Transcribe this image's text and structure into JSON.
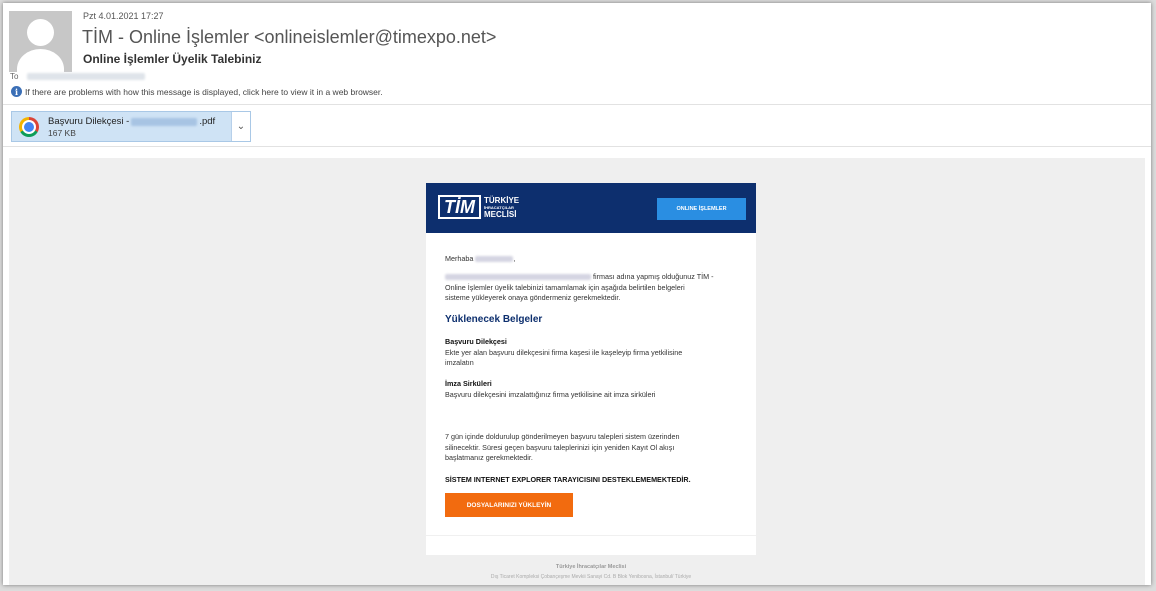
{
  "header": {
    "date": "Pzt 4.01.2021 17:27",
    "sender": "TİM - Online İşlemler <onlineislemler@timexpo.net>",
    "subject": "Online İşlemler Üyelik Talebiniz",
    "to_label": "To",
    "info_text": "If there are problems with how this message is displayed, click here to view it in a web browser."
  },
  "attachment": {
    "name_prefix": "Başvuru Dilekçesi - ",
    "name_suffix": ".pdf",
    "size": "167 KB"
  },
  "email": {
    "logo_text": "TİM",
    "logo_line1": "TÜRKİYE",
    "logo_line2": "İHRACATÇILAR",
    "logo_line3": "MECLİSİ",
    "online_button": "ONLINE İŞLEMLER",
    "greeting_prefix": "Merhaba",
    "para1_suffix": "firması adına yapmış olduğunuz TİM -",
    "para1_line2": "Online İşlemler üyelik talebinizi tamamlamak için aşağıda belirtilen belgeleri",
    "para1_line3": "sisteme yükleyerek onaya göndermeniz gerekmektedir.",
    "documents_heading": "Yüklenecek Belgeler",
    "doc1_title": "Başvuru Dilekçesi",
    "doc1_line1": "Ekte yer alan başvuru dilekçesini firma kaşesi ile kaşeleyip firma yetkilisine",
    "doc1_line2": "imzalatın",
    "doc2_title": "İmza Sirküleri",
    "doc2_line1": "Başvuru dilekçesini imzalattığınız firma yetkilisine ait imza sirküleri",
    "para2_line1": "7 gün içinde doldurulup gönderilmeyen başvuru talepleri sistem üzerinden",
    "para2_line2": "silinecektir. Süresi geçen başvuru taleplerinizi için yeniden Kayıt Ol akışı",
    "para2_line3": "başlatmanız gerekmektedir.",
    "warning": "SİSTEM INTERNET EXPLORER TARAYICISINI DESTEKLEMEMEKTEDİR.",
    "upload_button": "DOSYALARINIZI YÜKLEYİN",
    "footer_org": "Türkiye İhracatçılar Meclisi",
    "footer_address": "Dış Ticaret Kompleksi Çobançeşme Mevkii Sanayi Cd. B Blok Yenibosna, İstanbul/ Türkiye"
  }
}
